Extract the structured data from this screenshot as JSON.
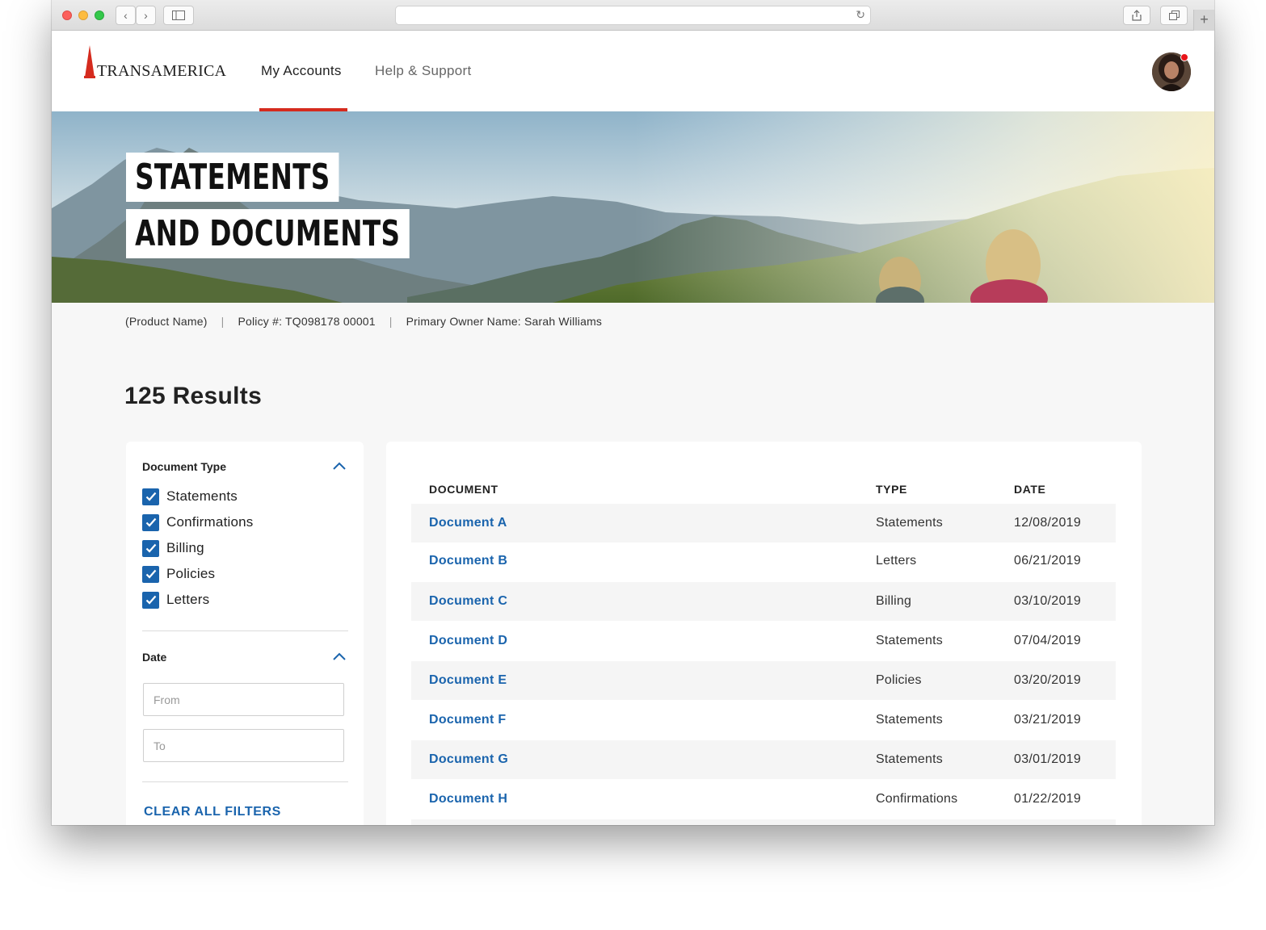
{
  "header": {
    "logo_text": "TRANSAMERICA",
    "nav": [
      {
        "label": "My Accounts",
        "active": true
      },
      {
        "label": "Help & Support",
        "active": false
      }
    ]
  },
  "hero": {
    "title_line1": "STATEMENTS",
    "title_line2": "AND DOCUMENTS"
  },
  "policy": {
    "product": "(Product Name)",
    "separator": "|",
    "policy_number": "Policy #: TQ098178 00001",
    "owner": "Primary Owner Name: Sarah Williams"
  },
  "results": {
    "title": "125 Results"
  },
  "filters": {
    "document_type": {
      "heading": "Document Type",
      "options": [
        {
          "label": "Statements",
          "checked": true
        },
        {
          "label": "Confirmations",
          "checked": true
        },
        {
          "label": "Billing",
          "checked": true
        },
        {
          "label": "Policies",
          "checked": true
        },
        {
          "label": "Letters",
          "checked": true
        }
      ]
    },
    "date": {
      "heading": "Date",
      "from_placeholder": "From",
      "to_placeholder": "To"
    },
    "clear_label": "CLEAR ALL FILTERS"
  },
  "table": {
    "columns": [
      "DOCUMENT",
      "TYPE",
      "DATE"
    ],
    "rows": [
      {
        "document": "Document A",
        "type": "Statements",
        "date": "12/08/2019"
      },
      {
        "document": "Document B",
        "type": "Letters",
        "date": "06/21/2019"
      },
      {
        "document": "Document C",
        "type": "Billing",
        "date": "03/10/2019"
      },
      {
        "document": "Document D",
        "type": "Statements",
        "date": "07/04/2019"
      },
      {
        "document": "Document E",
        "type": "Policies",
        "date": "03/20/2019"
      },
      {
        "document": "Document F",
        "type": "Statements",
        "date": "03/21/2019"
      },
      {
        "document": "Document G",
        "type": "Statements",
        "date": "03/01/2019"
      },
      {
        "document": "Document H",
        "type": "Confirmations",
        "date": "01/22/2019"
      }
    ]
  },
  "colors": {
    "brand_red": "#d52b1e",
    "link_blue": "#1a64ad",
    "page_bg": "#f7f7f7"
  }
}
